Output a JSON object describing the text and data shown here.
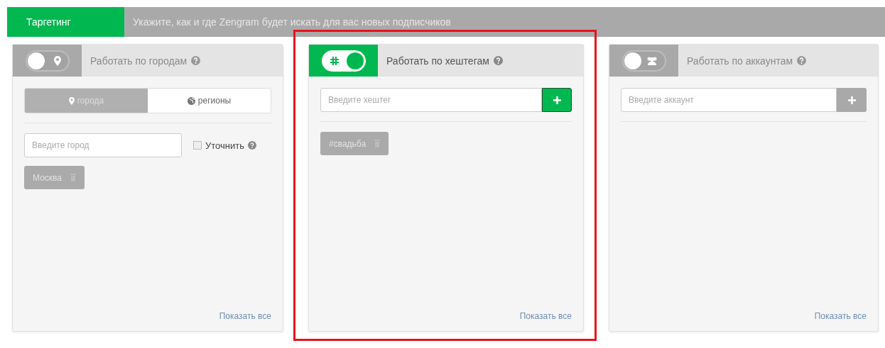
{
  "header": {
    "tab": "Таргетинг",
    "hint": "Укажите, как и где Zengram будет искать для вас новых подписчиков"
  },
  "panels": [
    {
      "kind": "cities",
      "on": false,
      "highlighted": false,
      "title": "Работать по городам",
      "segments": [
        {
          "label": "города",
          "selected": true
        },
        {
          "label": "регионы",
          "selected": false
        }
      ],
      "input": {
        "placeholder": "Введите город"
      },
      "checkbox": {
        "label": "Уточнить",
        "checked": false
      },
      "tags": [
        "Москва"
      ],
      "show_all": "Показать все"
    },
    {
      "kind": "hashtags",
      "on": true,
      "highlighted": true,
      "title": "Работать по хештегам",
      "input": {
        "placeholder": "Введите хештег"
      },
      "tags": [
        "#свадьба"
      ],
      "show_all": "Показать все"
    },
    {
      "kind": "accounts",
      "on": false,
      "highlighted": false,
      "title": "Работать по аккаунтам",
      "input": {
        "placeholder": "Введите аккаунт"
      },
      "show_all": "Показать все"
    }
  ]
}
